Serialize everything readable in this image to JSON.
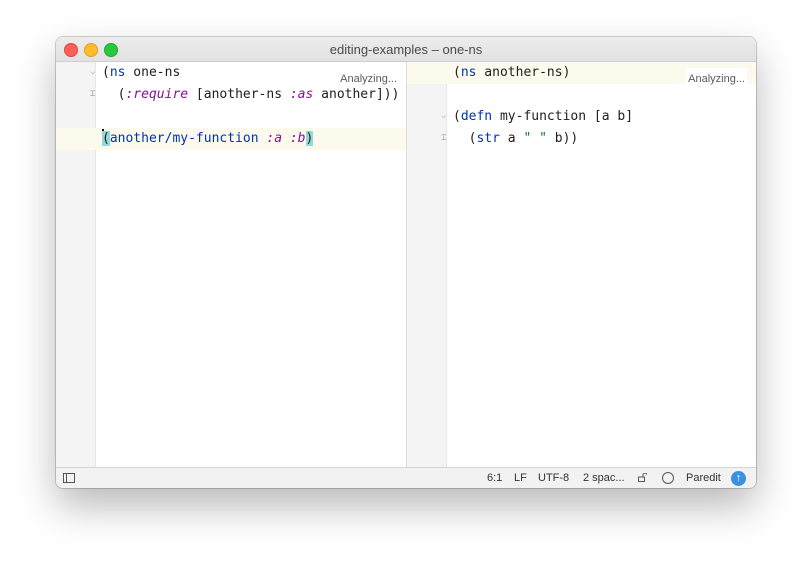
{
  "window": {
    "title": "editing-examples – one-ns"
  },
  "left_editor": {
    "status": "Analyzing...",
    "lines": [
      {
        "paren": "(",
        "kw": "ns",
        "rest": " one-ns"
      },
      {
        "indent": "  ",
        "paren": "(",
        "kwd": ":require",
        "rest1": " [another-ns ",
        "kwd2": ":as",
        "rest2": " another]))"
      },
      {
        "text": ""
      },
      {
        "open": "(",
        "fn": "another/my-function",
        "sp1": " ",
        "k1": ":a",
        "sp2": " ",
        "k2": ":b",
        "close": ")"
      }
    ]
  },
  "right_editor": {
    "status": "Analyzing...",
    "lines": [
      {
        "paren": "(",
        "kw": "ns",
        "rest": " another-ns)"
      },
      {
        "text": ""
      },
      {
        "paren": "(",
        "kw": "defn",
        "rest": " my-function [a b]"
      },
      {
        "indent": "  ",
        "paren": "(",
        "kw": "str",
        "rest1": " a ",
        "s": "\" \"",
        "rest2": " b))"
      }
    ]
  },
  "statusbar": {
    "position": "6:1",
    "line_separator": "LF",
    "encoding": "UTF-8",
    "indent": "2 spac...",
    "mode": "Paredit"
  },
  "icons": {
    "panel": "panel-toggle-icon",
    "lock": "lock-icon",
    "inspection": "inspection-bubble-icon",
    "update": "update-arrow-icon"
  }
}
